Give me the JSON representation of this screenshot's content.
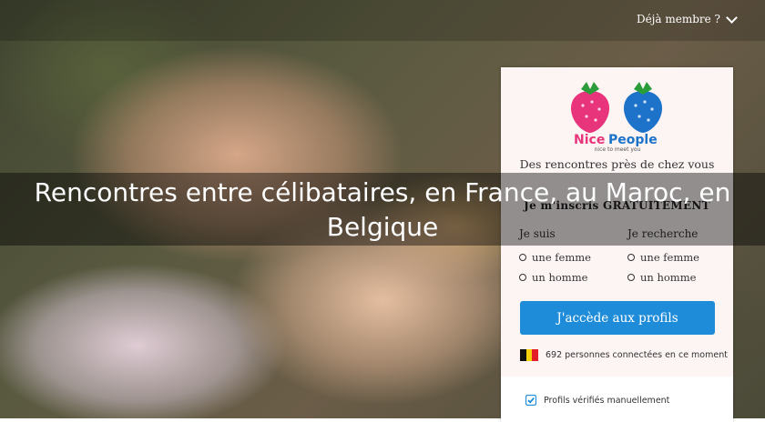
{
  "header": {
    "member_label": "Déjà membre ?"
  },
  "hero": {
    "headline": "Rencontres entre célibataires, en France, au Maroc, en Belgique"
  },
  "panel": {
    "logo": {
      "brand_nice": "Nice",
      "brand_people": "People",
      "brand_tagline": "nice to meet you"
    },
    "tagline": "Des rencontres près de chez vous",
    "subtitle": "Je m'inscris GRATUITEMENT",
    "i_am": {
      "label": "Je suis",
      "options": [
        "une femme",
        "un homme"
      ]
    },
    "looking_for": {
      "label": "Je recherche",
      "options": [
        "une femme",
        "un homme"
      ]
    },
    "cta_label": "J'accède aux profils",
    "online_text": "692 personnes connectées en ce moment",
    "verified_text": "Profils vérifiés manuellement"
  },
  "colors": {
    "accent": "#1f8cd9",
    "brand_pink": "#e8347a",
    "brand_blue": "#1d73c9",
    "panel_bg": "#fdf4f4"
  }
}
